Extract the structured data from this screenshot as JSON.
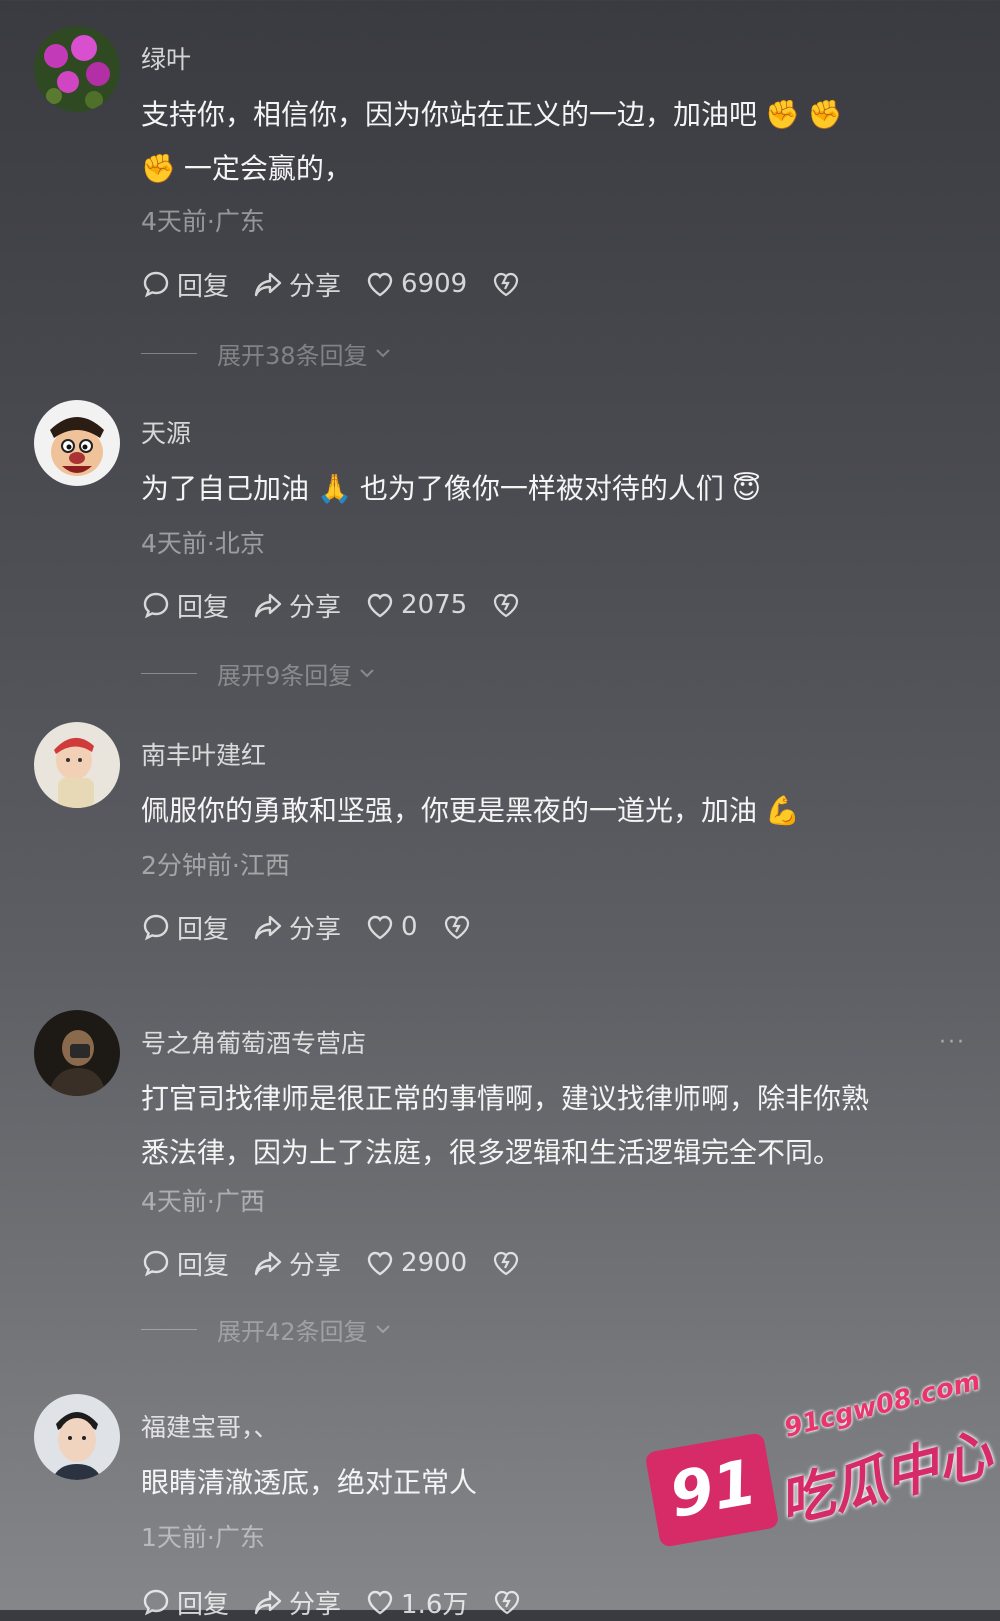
{
  "comments": [
    {
      "username": "绿叶",
      "text_line1": "支持你，相信你，因为你站在正义的一边，加油吧",
      "text_line2": "一定会赢的，",
      "emoji": "✊",
      "meta": "4天前·广东",
      "reply_label": "回复",
      "share_label": "分享",
      "likes": "6909",
      "expand_label": "展开38条回复"
    },
    {
      "username": "天源",
      "text_line1": "为了自己加油",
      "text_mid": "也为了像你一样被对待的人们",
      "emoji1": "🙏",
      "emoji2": "😇",
      "meta": "4天前·北京",
      "reply_label": "回复",
      "share_label": "分享",
      "likes": "2075",
      "expand_label": "展开9条回复"
    },
    {
      "username": "南丰叶建红",
      "text_line1": "佩服你的勇敢和坚强，你更是黑夜的一道光，加油",
      "emoji": "💪",
      "meta": "2分钟前·江西",
      "reply_label": "回复",
      "share_label": "分享",
      "likes": "0"
    },
    {
      "username": "号之角葡萄酒专营店",
      "text_line1": "打官司找律师是很正常的事情啊，建议找律师啊，除非你熟",
      "text_line2": "悉法律，因为上了法庭，很多逻辑和生活逻辑完全不同。",
      "meta": "4天前·广西",
      "reply_label": "回复",
      "share_label": "分享",
      "likes": "2900",
      "expand_label": "展开42条回复",
      "more_label": "···"
    },
    {
      "username": "福建宝哥，、",
      "text_line1": "眼睛清澈透底，绝对正常人",
      "meta": "1天前·广东",
      "reply_label": "回复",
      "share_label": "分享",
      "likes": "1.6万"
    }
  ],
  "watermark": {
    "url": "91cgw08.com",
    "number": "91",
    "name": "吃瓜中心"
  },
  "colors": {
    "accent": "#d62b66"
  }
}
